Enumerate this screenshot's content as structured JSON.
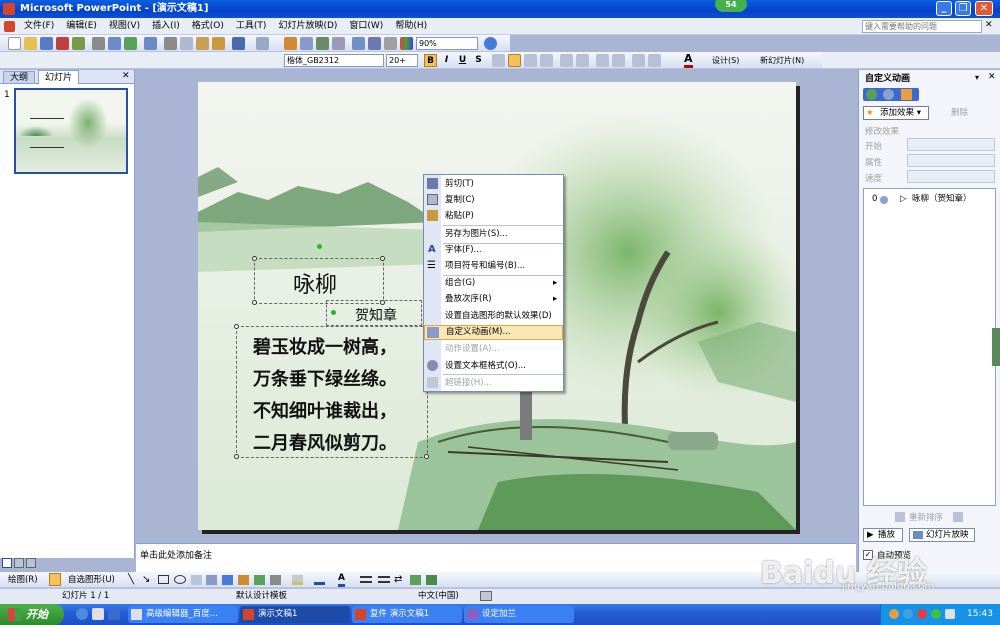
{
  "window": {
    "title": "Microsoft PowerPoint - [演示文稿1]",
    "badge": "54"
  },
  "menu": {
    "items": [
      "文件(F)",
      "编辑(E)",
      "视图(V)",
      "插入(I)",
      "格式(O)",
      "工具(T)",
      "幻灯片放映(D)",
      "窗口(W)",
      "帮助(H)"
    ],
    "help_placeholder": "键入需要帮助的问题"
  },
  "toolbar": {
    "zoom": "90%",
    "font": "楷体_GB2312",
    "font_size": "20+",
    "bold": "B",
    "italic": "I",
    "underline": "U",
    "shadow": "S",
    "design": "设计(S)",
    "new_slide": "新幻灯片(N)"
  },
  "left_pane": {
    "tabs": [
      "大纲",
      "幻灯片"
    ],
    "slide_number": "1"
  },
  "slide": {
    "title": "咏柳",
    "author": "贺知章",
    "lines": [
      "碧玉妆成一树高，",
      "万条垂下绿丝绦。",
      "不知细叶谁裁出，",
      "二月春风似剪刀。"
    ]
  },
  "context_menu": {
    "items": [
      {
        "label": "剪切(T)",
        "icon": "scissors-icon",
        "enabled": true
      },
      {
        "label": "复制(C)",
        "icon": "copy-icon",
        "enabled": true
      },
      {
        "label": "粘贴(P)",
        "icon": "paste-icon",
        "enabled": true
      },
      {
        "label": "另存为图片(S)...",
        "icon": "",
        "enabled": true
      },
      {
        "label": "字体(F)...",
        "icon": "font-icon",
        "enabled": true
      },
      {
        "label": "项目符号和编号(B)...",
        "icon": "bullets-icon",
        "enabled": true
      },
      {
        "label": "组合(G)",
        "icon": "",
        "enabled": true,
        "submenu": true
      },
      {
        "label": "叠放次序(R)",
        "icon": "",
        "enabled": true,
        "submenu": true
      },
      {
        "label": "设置自选图形的默认效果(D)",
        "icon": "",
        "enabled": true
      },
      {
        "label": "自定义动画(M)...",
        "icon": "animation-icon",
        "enabled": true,
        "highlighted": true
      },
      {
        "label": "动作设置(A)...",
        "icon": "",
        "enabled": false
      },
      {
        "label": "设置文本框格式(O)...",
        "icon": "format-icon",
        "enabled": true
      },
      {
        "label": "超链接(H)...",
        "icon": "hyperlink-icon",
        "enabled": false
      }
    ]
  },
  "task_pane": {
    "title": "自定义动画",
    "add_effect": "添加效果",
    "remove": "删除",
    "modify_label": "修改效果",
    "start_label": "开始",
    "property_label": "属性",
    "speed_label": "速度",
    "list_item_index": "0",
    "list_item_label": "咏柳（贺知章）",
    "reorder": "重新排序",
    "play": "播放",
    "slideshow": "幻灯片放映",
    "autopreview": "自动预览"
  },
  "notes": {
    "placeholder": "单击此处添加备注"
  },
  "drawbar": {
    "draw": "绘图(R)",
    "autoshapes": "自选图形(U)"
  },
  "status": {
    "slide": "幻灯片 1 / 1",
    "template": "默认设计模板",
    "language": "中文(中国)"
  },
  "taskbar": {
    "start": "开始",
    "tasks": [
      "高级编辑器_百度...",
      "演示文稿1",
      "复件 演示文稿1",
      "设定加兰"
    ],
    "clock": "15:43"
  },
  "watermark": {
    "brand": "Baidu 经验",
    "url": "jingyan.baidu.com"
  }
}
